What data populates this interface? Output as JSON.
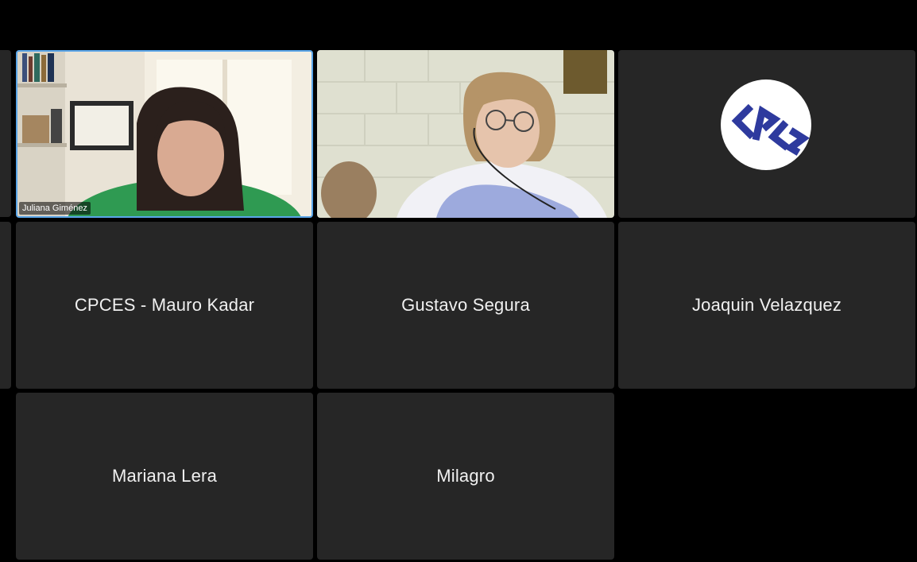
{
  "meeting": {
    "participants": [
      {
        "id": "juliana",
        "name": "Juliana Giménez",
        "video": true,
        "active_speaker": true
      },
      {
        "id": "cam2",
        "name": "",
        "video": true,
        "active_speaker": false
      },
      {
        "id": "logo",
        "name": "",
        "video": false,
        "avatar": "cpce-logo",
        "avatar_text": "CPCE"
      },
      {
        "id": "mauro",
        "name": "CPCES - Mauro Kadar",
        "video": false
      },
      {
        "id": "gustavo",
        "name": "Gustavo Segura",
        "video": false
      },
      {
        "id": "joaquin",
        "name": "Joaquin Velazquez",
        "video": false
      },
      {
        "id": "mariana",
        "name": "Mariana Lera",
        "video": false
      },
      {
        "id": "milagro",
        "name": "Milagro",
        "video": false
      }
    ]
  },
  "colors": {
    "background": "#000000",
    "tile": "#262626",
    "active_border": "#5aa5e8",
    "logo_blue": "#2e3a9e"
  },
  "icons": {
    "avatar_logo": "cpce-logo"
  }
}
